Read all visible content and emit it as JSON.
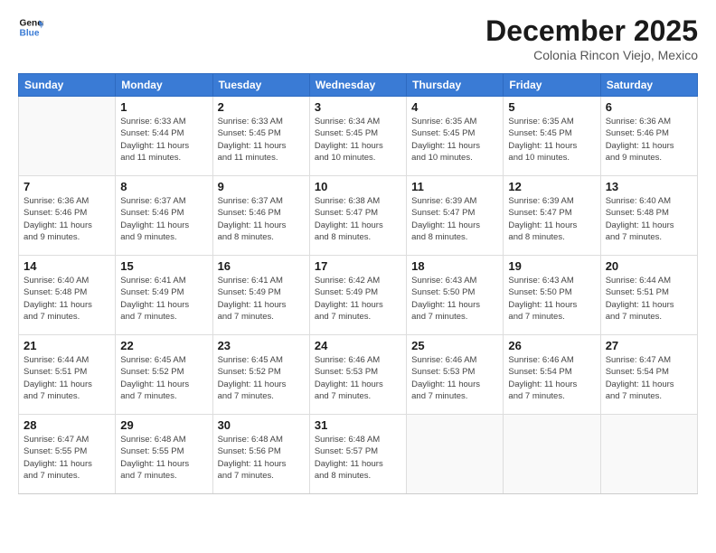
{
  "logo": {
    "line1": "General",
    "line2": "Blue"
  },
  "title": "December 2025",
  "location": "Colonia Rincon Viejo, Mexico",
  "days_of_week": [
    "Sunday",
    "Monday",
    "Tuesday",
    "Wednesday",
    "Thursday",
    "Friday",
    "Saturday"
  ],
  "weeks": [
    [
      {
        "day": "",
        "info": ""
      },
      {
        "day": "1",
        "info": "Sunrise: 6:33 AM\nSunset: 5:44 PM\nDaylight: 11 hours\nand 11 minutes."
      },
      {
        "day": "2",
        "info": "Sunrise: 6:33 AM\nSunset: 5:45 PM\nDaylight: 11 hours\nand 11 minutes."
      },
      {
        "day": "3",
        "info": "Sunrise: 6:34 AM\nSunset: 5:45 PM\nDaylight: 11 hours\nand 10 minutes."
      },
      {
        "day": "4",
        "info": "Sunrise: 6:35 AM\nSunset: 5:45 PM\nDaylight: 11 hours\nand 10 minutes."
      },
      {
        "day": "5",
        "info": "Sunrise: 6:35 AM\nSunset: 5:45 PM\nDaylight: 11 hours\nand 10 minutes."
      },
      {
        "day": "6",
        "info": "Sunrise: 6:36 AM\nSunset: 5:46 PM\nDaylight: 11 hours\nand 9 minutes."
      }
    ],
    [
      {
        "day": "7",
        "info": "Sunrise: 6:36 AM\nSunset: 5:46 PM\nDaylight: 11 hours\nand 9 minutes."
      },
      {
        "day": "8",
        "info": "Sunrise: 6:37 AM\nSunset: 5:46 PM\nDaylight: 11 hours\nand 9 minutes."
      },
      {
        "day": "9",
        "info": "Sunrise: 6:37 AM\nSunset: 5:46 PM\nDaylight: 11 hours\nand 8 minutes."
      },
      {
        "day": "10",
        "info": "Sunrise: 6:38 AM\nSunset: 5:47 PM\nDaylight: 11 hours\nand 8 minutes."
      },
      {
        "day": "11",
        "info": "Sunrise: 6:39 AM\nSunset: 5:47 PM\nDaylight: 11 hours\nand 8 minutes."
      },
      {
        "day": "12",
        "info": "Sunrise: 6:39 AM\nSunset: 5:47 PM\nDaylight: 11 hours\nand 8 minutes."
      },
      {
        "day": "13",
        "info": "Sunrise: 6:40 AM\nSunset: 5:48 PM\nDaylight: 11 hours\nand 7 minutes."
      }
    ],
    [
      {
        "day": "14",
        "info": "Sunrise: 6:40 AM\nSunset: 5:48 PM\nDaylight: 11 hours\nand 7 minutes."
      },
      {
        "day": "15",
        "info": "Sunrise: 6:41 AM\nSunset: 5:49 PM\nDaylight: 11 hours\nand 7 minutes."
      },
      {
        "day": "16",
        "info": "Sunrise: 6:41 AM\nSunset: 5:49 PM\nDaylight: 11 hours\nand 7 minutes."
      },
      {
        "day": "17",
        "info": "Sunrise: 6:42 AM\nSunset: 5:49 PM\nDaylight: 11 hours\nand 7 minutes."
      },
      {
        "day": "18",
        "info": "Sunrise: 6:43 AM\nSunset: 5:50 PM\nDaylight: 11 hours\nand 7 minutes."
      },
      {
        "day": "19",
        "info": "Sunrise: 6:43 AM\nSunset: 5:50 PM\nDaylight: 11 hours\nand 7 minutes."
      },
      {
        "day": "20",
        "info": "Sunrise: 6:44 AM\nSunset: 5:51 PM\nDaylight: 11 hours\nand 7 minutes."
      }
    ],
    [
      {
        "day": "21",
        "info": "Sunrise: 6:44 AM\nSunset: 5:51 PM\nDaylight: 11 hours\nand 7 minutes."
      },
      {
        "day": "22",
        "info": "Sunrise: 6:45 AM\nSunset: 5:52 PM\nDaylight: 11 hours\nand 7 minutes."
      },
      {
        "day": "23",
        "info": "Sunrise: 6:45 AM\nSunset: 5:52 PM\nDaylight: 11 hours\nand 7 minutes."
      },
      {
        "day": "24",
        "info": "Sunrise: 6:46 AM\nSunset: 5:53 PM\nDaylight: 11 hours\nand 7 minutes."
      },
      {
        "day": "25",
        "info": "Sunrise: 6:46 AM\nSunset: 5:53 PM\nDaylight: 11 hours\nand 7 minutes."
      },
      {
        "day": "26",
        "info": "Sunrise: 6:46 AM\nSunset: 5:54 PM\nDaylight: 11 hours\nand 7 minutes."
      },
      {
        "day": "27",
        "info": "Sunrise: 6:47 AM\nSunset: 5:54 PM\nDaylight: 11 hours\nand 7 minutes."
      }
    ],
    [
      {
        "day": "28",
        "info": "Sunrise: 6:47 AM\nSunset: 5:55 PM\nDaylight: 11 hours\nand 7 minutes."
      },
      {
        "day": "29",
        "info": "Sunrise: 6:48 AM\nSunset: 5:55 PM\nDaylight: 11 hours\nand 7 minutes."
      },
      {
        "day": "30",
        "info": "Sunrise: 6:48 AM\nSunset: 5:56 PM\nDaylight: 11 hours\nand 7 minutes."
      },
      {
        "day": "31",
        "info": "Sunrise: 6:48 AM\nSunset: 5:57 PM\nDaylight: 11 hours\nand 8 minutes."
      },
      {
        "day": "",
        "info": ""
      },
      {
        "day": "",
        "info": ""
      },
      {
        "day": "",
        "info": ""
      }
    ]
  ]
}
